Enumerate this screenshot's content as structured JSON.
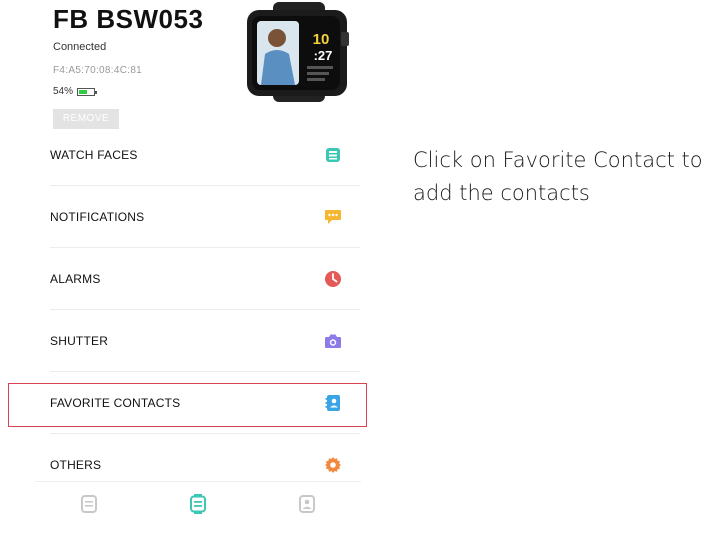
{
  "device": {
    "name": "FB BSW053",
    "status": "Connected",
    "mac": "F4:A5:70:08:4C:81",
    "battery": "54%",
    "battery_level": 0.54,
    "remove_label": "REMOVE"
  },
  "watch_screen": {
    "hour": "10",
    "minute": ":27"
  },
  "menu": {
    "items": [
      {
        "label": "WATCH FACES",
        "icon": "watch-face-icon",
        "color": "#3cc6b4"
      },
      {
        "label": "NOTIFICATIONS",
        "icon": "chat-bubble-icon",
        "color": "#f5b731"
      },
      {
        "label": "ALARMS",
        "icon": "clock-icon",
        "color": "#e45a57"
      },
      {
        "label": "SHUTTER",
        "icon": "camera-icon",
        "color": "#8e7bea"
      },
      {
        "label": "FAVORITE CONTACTS",
        "icon": "contact-book-icon",
        "color": "#3aa4e6"
      },
      {
        "label": "OTHERS",
        "icon": "gear-icon",
        "color": "#f08a3c"
      }
    ]
  },
  "nav": {
    "items": [
      {
        "icon": "watch-tab-icon",
        "color": "#c8c8c8"
      },
      {
        "icon": "device-tab-icon",
        "color": "#3cc6b4"
      },
      {
        "icon": "profile-tab-icon",
        "color": "#c8c8c8"
      }
    ]
  },
  "caption": "Click on Favorite Contact to add the contacts"
}
